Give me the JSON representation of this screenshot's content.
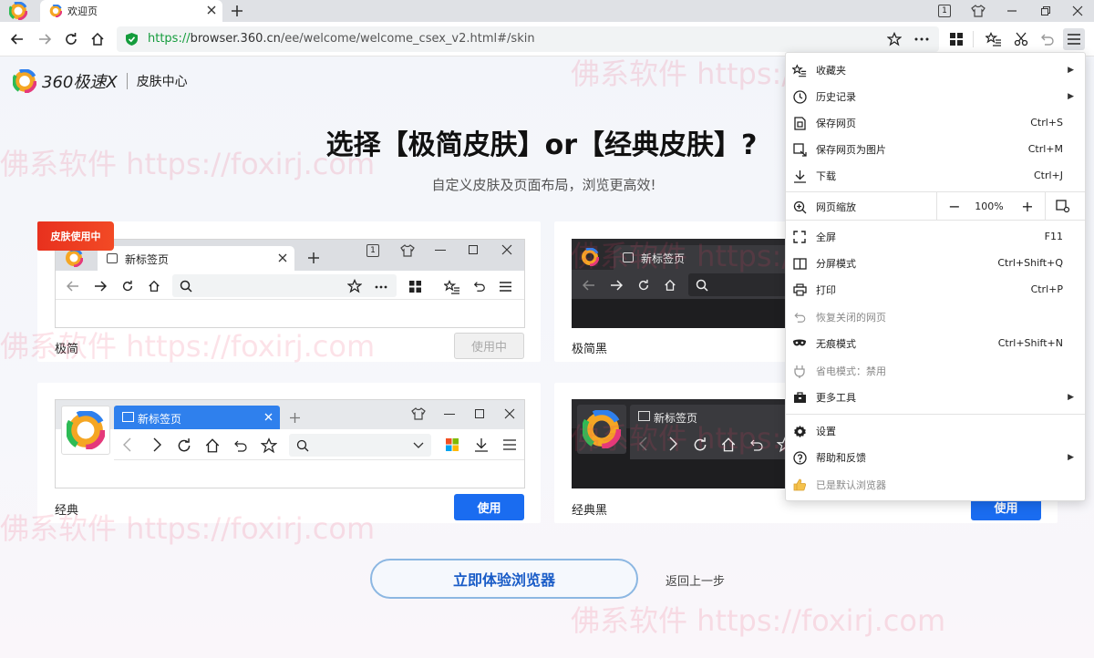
{
  "tab": {
    "title": "欢迎页"
  },
  "address": {
    "protocol": "https://",
    "host": "browser.360.cn",
    "path": "/ee/welcome/welcome_csex_v2.html#/skin"
  },
  "window": {
    "badge": "1"
  },
  "brand": {
    "name": "360极速X",
    "section": "皮肤中心"
  },
  "headline": "选择【极简皮肤】or【经典皮肤】?",
  "subline": "自定义皮肤及页面布局，浏览更高效!",
  "badge_in_use": "皮肤使用中",
  "cards": {
    "minimal": {
      "label": "极简",
      "button": "使用中",
      "tab_title": "新标签页",
      "badge": "1"
    },
    "minimal_dark": {
      "label": "极简黑",
      "tab_title": "新标签页"
    },
    "classic": {
      "label": "经典",
      "button": "使用",
      "tab_title": "新标签页"
    },
    "classic_dark": {
      "label": "经典黑",
      "button": "使用",
      "tab_title": "新标签页"
    }
  },
  "cta": {
    "primary": "立即体验浏览器",
    "secondary": "返回上一步"
  },
  "watermark": "佛系软件 https://foxirj.com",
  "menu": {
    "favorites": "收藏夹",
    "history": "历史记录",
    "save_page": "保存网页",
    "save_page_sc": "Ctrl+S",
    "save_image": "保存网页为图片",
    "save_image_sc": "Ctrl+M",
    "download": "下载",
    "download_sc": "Ctrl+J",
    "zoom": "网页缩放",
    "zoom_value": "100%",
    "zoom_minus": "−",
    "zoom_plus": "+",
    "fullscreen": "全屏",
    "fullscreen_sc": "F11",
    "split": "分屏模式",
    "split_sc": "Ctrl+Shift+Q",
    "print": "打印",
    "print_sc": "Ctrl+P",
    "restore": "恢复关闭的网页",
    "incognito": "无痕模式",
    "incognito_sc": "Ctrl+Shift+N",
    "power": "省电模式：禁用",
    "more_tools": "更多工具",
    "settings": "设置",
    "help": "帮助和反馈",
    "default": "已是默认浏览器"
  },
  "colors": {
    "accent": "#1a6cf0",
    "badge": "#e8311e",
    "secure": "#149c3c"
  }
}
